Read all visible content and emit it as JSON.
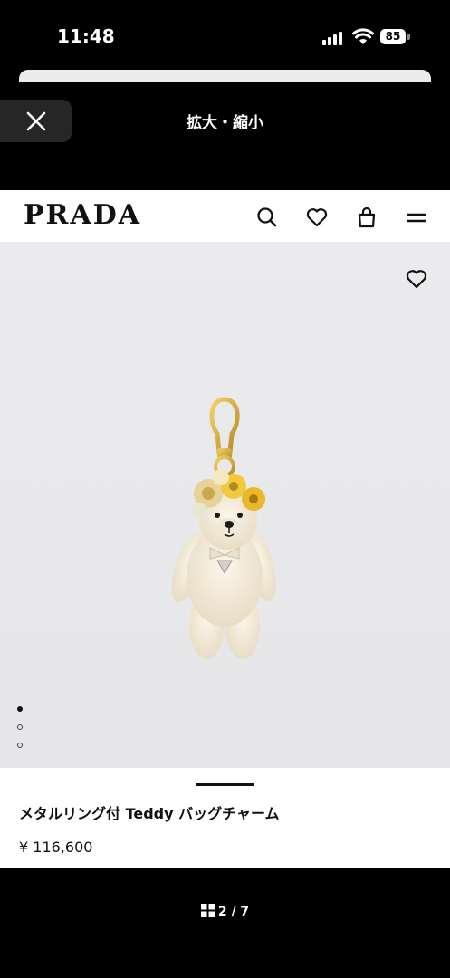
{
  "status_bar": {
    "time": "11:48",
    "battery": "85"
  },
  "viewer": {
    "title": "拡大・縮小",
    "counter": "2 / 7"
  },
  "site": {
    "logo": "PRADA",
    "product_name": "メタルリング付 Teddy バッグチャーム",
    "price": "¥ 116,600"
  },
  "carousel": {
    "active_index": 0,
    "total_dots": 3
  },
  "colors": {
    "background": "#000000",
    "page": "#ffffff",
    "image_bg": "#e9e9eb"
  }
}
